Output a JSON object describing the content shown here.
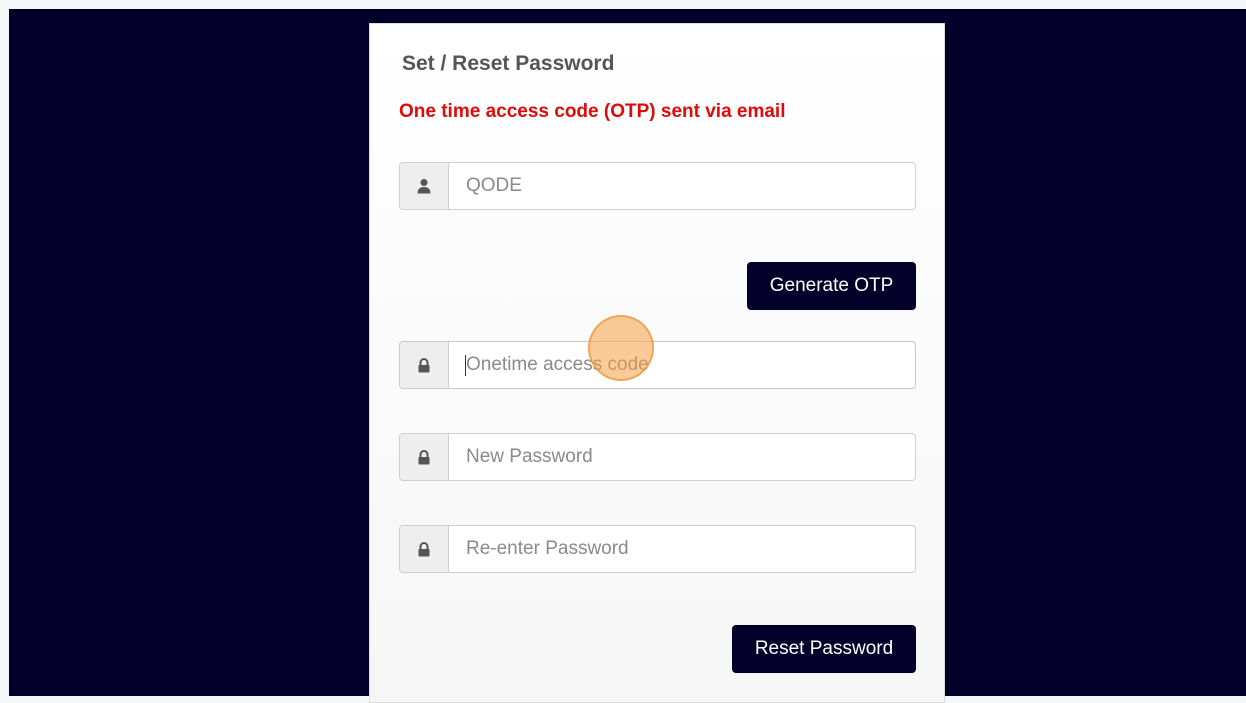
{
  "form": {
    "title": "Set / Reset Password",
    "notice": "One time access code (OTP) sent via email",
    "username": {
      "placeholder": "QODE",
      "icon": "user-icon"
    },
    "generate_otp_label": "Generate OTP",
    "otp": {
      "placeholder": "Onetime access code",
      "icon": "lock-icon"
    },
    "new_password": {
      "placeholder": "New Password",
      "icon": "lock-icon"
    },
    "reenter_password": {
      "placeholder": "Re-enter Password",
      "icon": "lock-icon"
    },
    "reset_label": "Reset Password"
  },
  "colors": {
    "backdrop": "#03002a",
    "button": "#03002a",
    "notice": "#e00a0a",
    "click_indicator": "#f5a046"
  }
}
